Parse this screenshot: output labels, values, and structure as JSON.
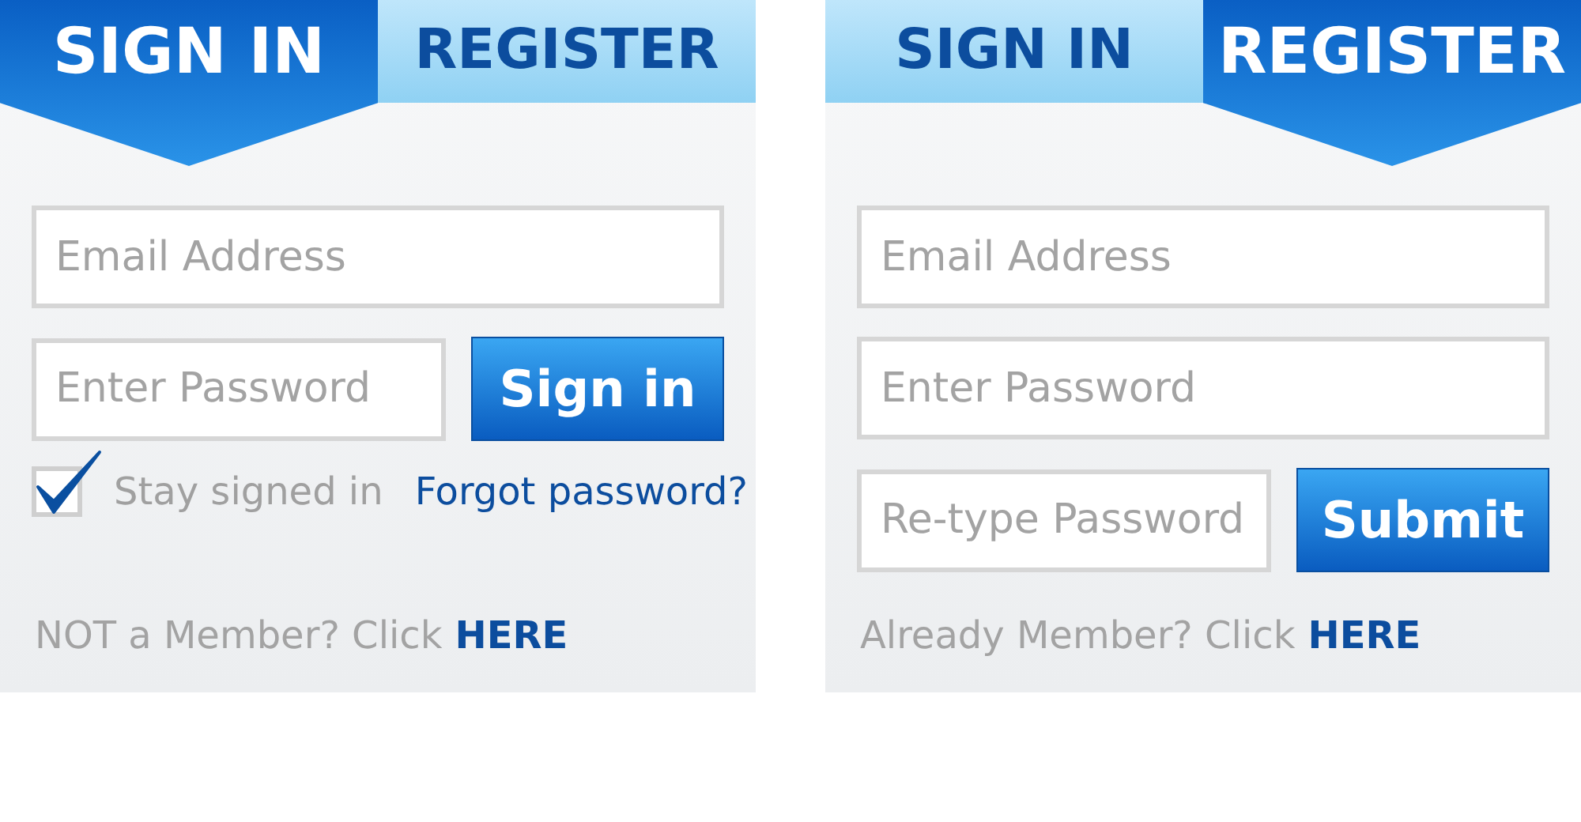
{
  "panels": [
    {
      "tabs": [
        {
          "label": "SIGN IN",
          "selected": true
        },
        {
          "label": "REGISTER",
          "selected": false
        }
      ],
      "rows": [
        {
          "kind": "field",
          "placeholder": "Email Address"
        },
        {
          "kind": "field_button",
          "placeholder": "Enter Password",
          "button": "Sign in"
        },
        {
          "kind": "options",
          "checkbox": {
            "label": "Stay signed in",
            "checked": true
          },
          "link": "Forgot password?"
        }
      ],
      "footer": {
        "text": "NOT a Member? Click",
        "link": "HERE"
      }
    },
    {
      "tabs": [
        {
          "label": "SIGN IN",
          "selected": false
        },
        {
          "label": "REGISTER",
          "selected": true
        }
      ],
      "rows": [
        {
          "kind": "field",
          "placeholder": "Email Address"
        },
        {
          "kind": "field",
          "placeholder": "Enter Password"
        },
        {
          "kind": "field_button",
          "placeholder": "Re-type Password",
          "button": "Submit"
        }
      ],
      "footer": {
        "text": "Already Member? Click",
        "link": "HERE"
      }
    }
  ]
}
